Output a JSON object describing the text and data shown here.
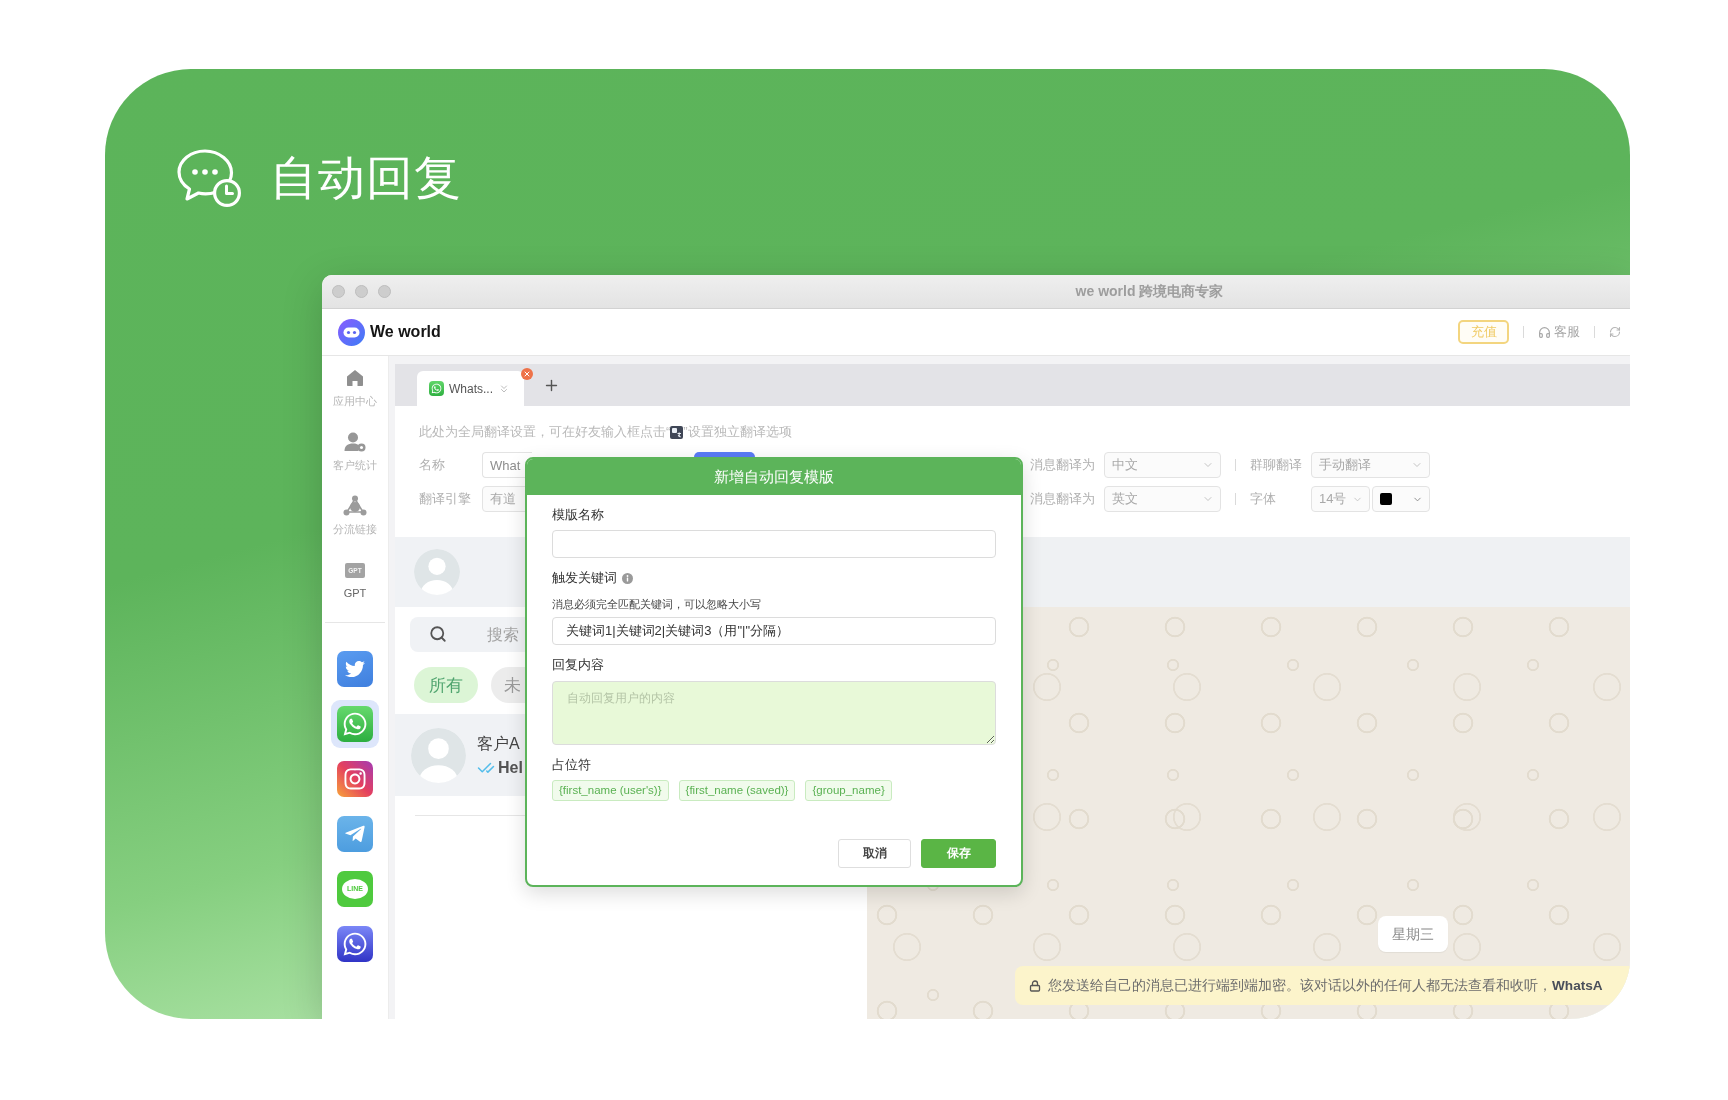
{
  "banner": {
    "title": "自动回复"
  },
  "window": {
    "title": "we world 跨境电商专家"
  },
  "app_header": {
    "brand": "We world",
    "recharge_button": "充值",
    "support_link": "客服"
  },
  "sidebar": {
    "items": [
      {
        "kind": "home",
        "label": "应用中心"
      },
      {
        "kind": "customer",
        "label": "客户统计"
      },
      {
        "kind": "network",
        "label": "分流链接"
      },
      {
        "kind": "gpt",
        "label": "GPT",
        "icon_text": "GPT"
      }
    ],
    "apps": [
      {
        "kind": "twitter",
        "selected": false
      },
      {
        "kind": "whatsapp",
        "selected": true
      },
      {
        "kind": "instagram",
        "selected": false
      },
      {
        "kind": "telegram",
        "selected": false
      },
      {
        "kind": "line",
        "selected": false,
        "icon_text": "LINE"
      },
      {
        "kind": "whatsapp_business",
        "selected": false
      }
    ]
  },
  "tabs": [
    {
      "label": "Whats...",
      "selected": true
    }
  ],
  "settings": {
    "hint_before": "此处为全局翻译设置，可在好友输入框点击“",
    "hint_after": "”设置独立翻译选项",
    "name": {
      "label": "名称",
      "value": "What"
    },
    "incoming": {
      "label": "消息翻译为",
      "value": "中文"
    },
    "group_chat": {
      "label": "群聊翻译",
      "value": "手动翻译"
    },
    "engine": {
      "label": "翻译引擎",
      "value": "有道"
    },
    "outgoing": {
      "label": "消息翻译为",
      "value": "英文"
    },
    "font": {
      "label": "字体",
      "size": "14号",
      "color": "#000000"
    }
  },
  "chat_list": {
    "search": {
      "placeholder": "搜索"
    },
    "filters": [
      {
        "label": "所有",
        "selected": true
      },
      {
        "label": "未",
        "selected": false
      }
    ],
    "chats": [
      {
        "name": "客户A",
        "preview": "Hel",
        "read": true
      }
    ]
  },
  "chat": {
    "date": "星期三",
    "notice": "您发送给自己的消息已进行端到端加密。该对话以外的任何人都无法查看和收听，**WhatsA**"
  },
  "dialog": {
    "title": "新增自动回复模版",
    "form": [
      {
        "kind": "label",
        "text": "模版名称"
      },
      {
        "kind": "input"
      },
      {
        "kind": "label",
        "text": "触发关键词",
        "info": true
      },
      {
        "kind": "hint",
        "text": "消息必须完全匹配关键词，可以忽略大小写"
      },
      {
        "kind": "input",
        "value": "关键词1|关键词2|关键词3（用\"|\"分隔）"
      },
      {
        "kind": "label",
        "text": "回复内容"
      },
      {
        "kind": "textarea",
        "placeholder": "自动回复用户的内容"
      },
      {
        "kind": "label",
        "text": "占位符"
      }
    ],
    "tags": [
      "{first_name (user's)}",
      "{first_name (saved)}",
      "{group_name}"
    ],
    "buttons": [
      {
        "kind": "secondary",
        "label": "取消"
      },
      {
        "kind": "primary",
        "label": "保存"
      }
    ]
  }
}
